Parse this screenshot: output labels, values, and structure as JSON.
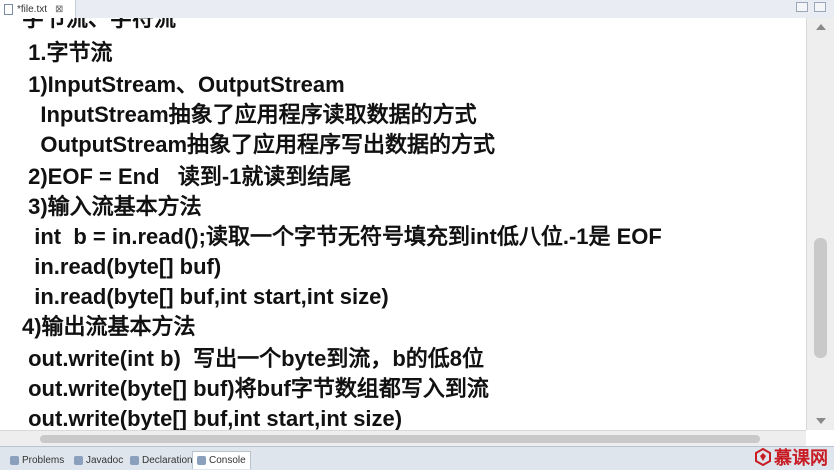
{
  "editor_tab": {
    "title": "*file.txt",
    "close": "⊠"
  },
  "editor_lines": [
    "字节流、字符流",
    " 1.字节流",
    " 1)InputStream、OutputStream",
    "   InputStream抽象了应用程序读取数据的方式",
    "   OutputStream抽象了应用程序写出数据的方式",
    " 2)EOF = End   读到-1就读到结尾",
    " 3)输入流基本方法",
    "  int  b = in.read();读取一个字节无符号填充到int低八位.-1是 EOF",
    "  in.read(byte[] buf)",
    "  in.read(byte[] buf,int start,int size)",
    "4)输出流基本方法",
    " out.write(int b)  写出一个byte到流，b的低8位",
    " out.write(byte[] buf)将buf字节数组都写入到流",
    " out.write(byte[] buf,int start,int size)"
  ],
  "bottom_tabs": [
    "Problems",
    "Javadoc",
    "Declaration",
    "Console"
  ],
  "logo_text": "慕课网",
  "colors": {
    "current_line": "#e8f2fe",
    "logo": "#c81d25"
  }
}
